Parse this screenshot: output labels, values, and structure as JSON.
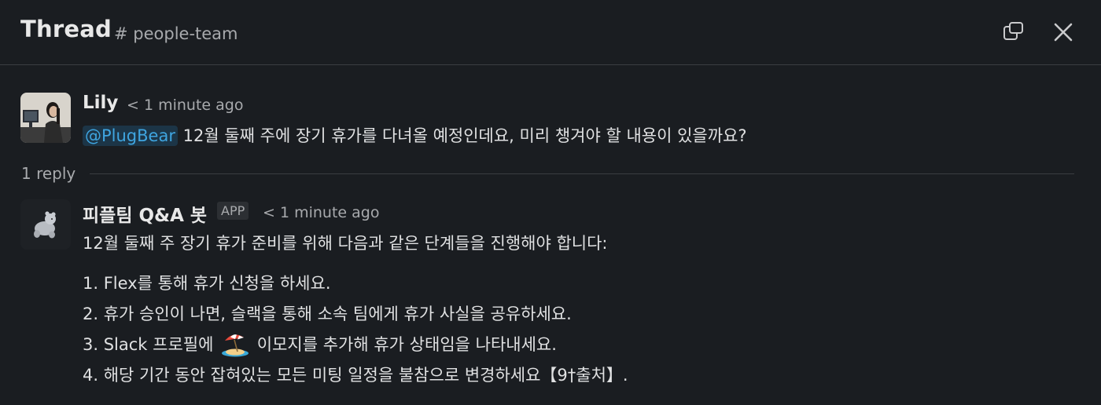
{
  "header": {
    "title": "Thread",
    "channel": "# people-team",
    "icons": {
      "popout": "popout-window-icon",
      "close": "close-icon"
    }
  },
  "messages": {
    "original": {
      "author": "Lily",
      "timestamp": "< 1 minute ago",
      "mention": "@PlugBear",
      "text": " 12월 둘째 주에 장기 휴가를 다녀올 예정인데요, 미리 챙겨야 할 내용이 있을까요?"
    },
    "reply_count": "1 reply",
    "reply": {
      "author": "피플팀 Q&A 봇",
      "badge": "APP",
      "timestamp": "< 1 minute ago",
      "intro": "12월 둘째 주 장기 휴가 준비를 위해 다음과 같은 단계들을 진행해야 합니다:",
      "items": [
        "1. Flex를 통해 휴가 신청을 하세요.",
        "2. 휴가 승인이 나면, 슬랙을 통해 소속 팀에게 휴가 사실을 공유하세요."
      ],
      "item3_before": "3. Slack 프로필에 ",
      "item3_emoji": "beach-with-umbrella-icon",
      "item3_after": " 이모지를 추가해 휴가 상태임을 나타내세요.",
      "item4": "4. 해당 기간 동안 잡혀있는 모든 미팅 일정을 불참으로 변경하세요【9†출처】."
    }
  },
  "colors": {
    "background": "#1a1d21",
    "mention_text": "#3fa5e0",
    "mention_bg": "#1c3547",
    "divider": "#3a3d42"
  }
}
